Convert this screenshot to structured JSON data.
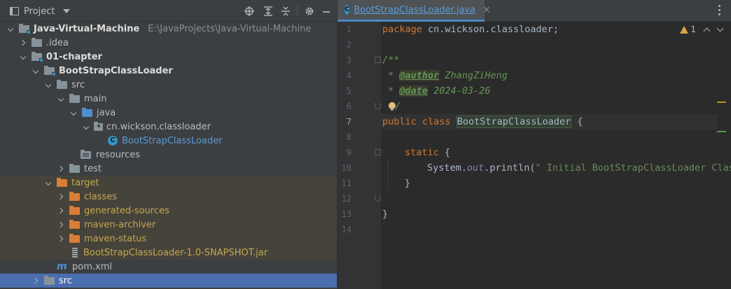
{
  "project_panel": {
    "title": "Project",
    "header_icons": [
      "crosshair-icon",
      "expand-all-icon",
      "collapse-all-icon",
      "gear-icon",
      "minimize-icon"
    ],
    "tree": [
      {
        "label": "Java-Virtual-Machine",
        "path": "E:\\JavaProjects\\Java-Virtual-Machine",
        "icon": "module-folder-icon",
        "expanded": true
      },
      {
        "label": ".idea",
        "icon": "folder-icon",
        "expanded": false
      },
      {
        "label": "01-chapter",
        "icon": "module-folder-icon",
        "expanded": true
      },
      {
        "label": "BootStrapClassLoader",
        "icon": "module-folder-icon",
        "expanded": true
      },
      {
        "label": "src",
        "icon": "folder-icon",
        "expanded": true
      },
      {
        "label": "main",
        "icon": "folder-icon",
        "expanded": true
      },
      {
        "label": "java",
        "icon": "source-folder-icon",
        "expanded": true
      },
      {
        "label": "cn.wickson.classloader",
        "icon": "package-icon",
        "expanded": true
      },
      {
        "label": "BootStrapClassLoader",
        "icon": "class-icon"
      },
      {
        "label": "resources",
        "icon": "resources-folder-icon"
      },
      {
        "label": "test",
        "icon": "folder-icon",
        "expanded": false
      },
      {
        "label": "target",
        "icon": "excluded-folder-icon",
        "expanded": true
      },
      {
        "label": "classes",
        "icon": "excluded-folder-icon",
        "expanded": false
      },
      {
        "label": "generated-sources",
        "icon": "excluded-folder-icon",
        "expanded": false
      },
      {
        "label": "maven-archiver",
        "icon": "excluded-folder-icon",
        "expanded": false
      },
      {
        "label": "maven-status",
        "icon": "excluded-folder-icon",
        "expanded": false
      },
      {
        "label": "BootStrapClassLoader-1.0-SNAPSHOT.jar",
        "icon": "jar-icon"
      },
      {
        "label": "pom.xml",
        "icon": "maven-icon"
      },
      {
        "label": "src",
        "icon": "folder-icon",
        "expanded": false,
        "selected": true
      }
    ]
  },
  "editor": {
    "tab": {
      "label": "BootStrapClassLoader.java",
      "close": "×"
    },
    "inspections": {
      "warnings": "1"
    },
    "line_numbers": [
      "1",
      "2",
      "3",
      "4",
      "5",
      "6",
      "7",
      "8",
      "9",
      "10",
      "11",
      "12",
      "13",
      "14"
    ],
    "current_line": "7",
    "code": {
      "l1_kw": "package",
      "l1_rest": " cn.wickson.classloader;",
      "l3": "/**",
      "l4_star": " * ",
      "l4_tag": "@author",
      "l4_val": " ZhangZiHeng",
      "l5_star": " * ",
      "l5_tag": "@date",
      "l5_val": " 2024-03-26",
      "l6": "/",
      "l7_kw1": "public",
      "l7_kw2": "class",
      "l7_name": "BootStrapClassLoader",
      "l7_rest": " {",
      "l9_kw": "static",
      "l9_rest": " {",
      "l10_a": "System.",
      "l10_field": "out",
      "l10_b": ".println(",
      "l10_str": "\" Initial BootStrapClassLoader Class",
      "l11": "}",
      "l13": "}"
    }
  }
}
